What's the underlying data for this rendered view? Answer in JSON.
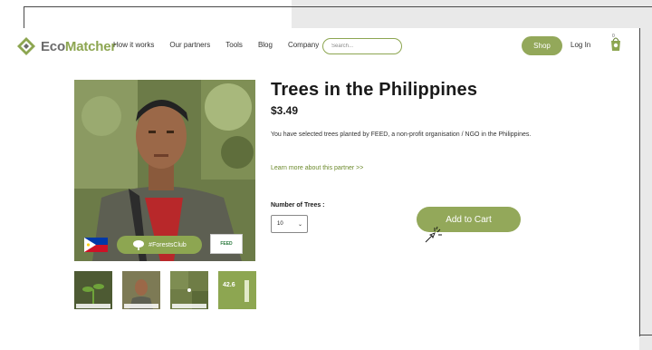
{
  "brand": {
    "name_part1": "Eco",
    "name_part2": "Matcher",
    "accent": "#8da651"
  },
  "nav": {
    "items": [
      "How it works",
      "Our partners",
      "Tools",
      "Blog",
      "Company"
    ]
  },
  "search": {
    "placeholder": "Search..."
  },
  "header": {
    "shop_label": "Shop",
    "login_label": "Log In",
    "cart_count": "0"
  },
  "product": {
    "title": "Trees in the Philippines",
    "price": "$3.49",
    "description": "You have selected trees planted by FEED, a non-profit organisation / NGO in the Philippines.",
    "learn_more": "Learn more about this partner >>",
    "quantity_label": "Number of Trees :",
    "quantity_value": "10",
    "add_to_cart_label": "Add to Cart"
  },
  "image_overlay": {
    "club_tag": "#ForestsClub",
    "partner_badge": "FEED"
  },
  "thumbnails": [
    {
      "caption": "",
      "icon": "seedling-photo"
    },
    {
      "caption": "",
      "icon": "person-photo"
    },
    {
      "caption": "",
      "icon": "aerial-map"
    },
    {
      "caption": "",
      "stat": "42.6"
    }
  ],
  "icons": {
    "logo": "ecomatcher-logo-icon",
    "cart": "cart-icon",
    "flag": "philippines-flag-icon",
    "cursor": "click-cursor-icon"
  }
}
